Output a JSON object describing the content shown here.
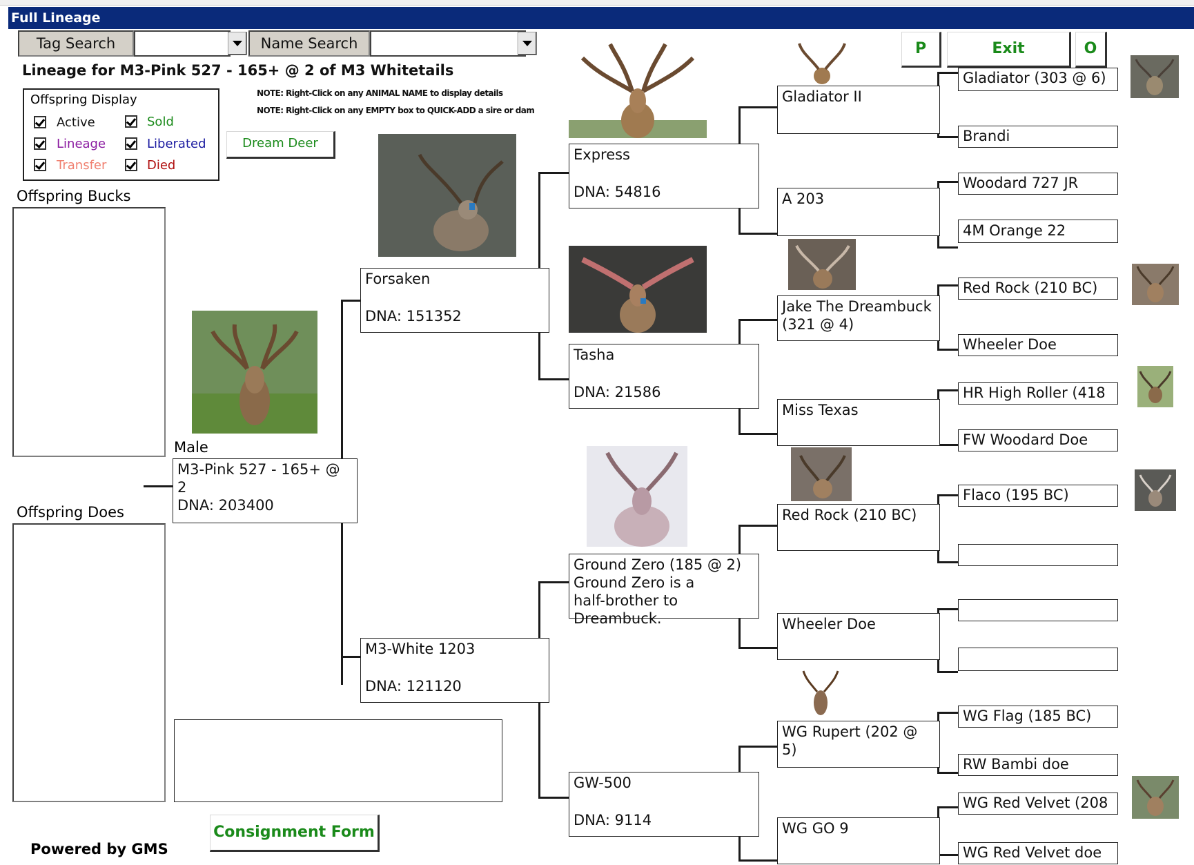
{
  "window": {
    "title": "Full Lineage"
  },
  "search": {
    "tag_label": "Tag Search",
    "name_label": "Name Search"
  },
  "heading": "Lineage for M3-Pink 527 - 165+ @ 2 of M3 Whitetails",
  "notes": [
    "NOTE: Right-Click on any ANIMAL NAME to display details",
    "NOTE: Right-Click on any EMPTY box to QUICK-ADD a sire or dam"
  ],
  "offspring_display": {
    "legend": "Offspring Display",
    "options": [
      {
        "label": "Active",
        "color": "#111111"
      },
      {
        "label": "Sold",
        "color": "#1a8a1a"
      },
      {
        "label": "Lineage",
        "color": "#8a1aa0"
      },
      {
        "label": "Liberated",
        "color": "#1a1aa0"
      },
      {
        "label": "Transfer",
        "color": "#f08070"
      },
      {
        "label": "Died",
        "color": "#b01010"
      }
    ]
  },
  "buttons": {
    "dream_deer": "Dream Deer",
    "p": "P",
    "exit": "Exit",
    "o": "O",
    "consignment": "Consignment Form"
  },
  "offspring_bucks_label": "Offspring Bucks",
  "offspring_does_label": "Offspring Does",
  "powered_by": "Powered by GMS",
  "subject": {
    "sex": "Male",
    "name": "M3-Pink 527 - 165+ @ 2",
    "dna": "DNA: 203400"
  },
  "gen1": {
    "sire": {
      "name": "Forsaken",
      "dna": "DNA: 151352"
    },
    "dam": {
      "name": "M3-White 1203",
      "dna": "DNA: 121120"
    }
  },
  "gen2": {
    "ss": {
      "name": "Express",
      "dna": "DNA: 54816"
    },
    "sd": {
      "name": "Tasha",
      "dna": "DNA: 21586"
    },
    "ds": {
      "name": "Ground Zero (185 @ 2)",
      "note": "Ground Zero is a half-brother to Dreambuck."
    },
    "dd": {
      "name": "GW-500",
      "dna": "DNA: 9114"
    }
  },
  "gen3": [
    {
      "name": "Gladiator II"
    },
    {
      "name": "A 203"
    },
    {
      "name": "Jake The Dreambuck (321 @ 4)"
    },
    {
      "name": "Miss Texas"
    },
    {
      "name": "Red Rock (210 BC)"
    },
    {
      "name": "Wheeler Doe"
    },
    {
      "name": "WG Rupert (202 @ 5)"
    },
    {
      "name": "WG GO 9"
    }
  ],
  "gen4": [
    "Gladiator (303 @ 6)",
    "Brandi",
    "Woodard 727 JR",
    "4M Orange 22",
    "Red Rock (210 BC)",
    "Wheeler Doe",
    "HR High Roller (418",
    "FW Woodard Doe",
    "Flaco (195 BC)",
    "",
    "",
    "",
    "WG Flag (185 BC)",
    "RW Bambi doe",
    "WG Red Velvet (208",
    "WG Red Velvet doe"
  ]
}
